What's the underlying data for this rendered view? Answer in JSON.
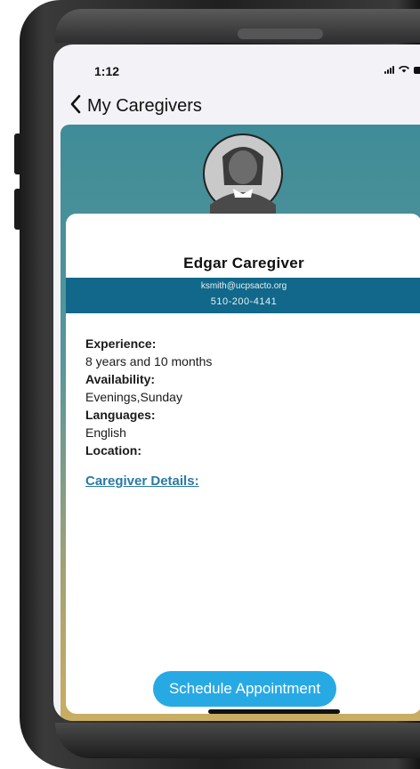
{
  "status_bar": {
    "time": "1:12"
  },
  "nav": {
    "back_title": "My Caregivers"
  },
  "profile": {
    "name": "Edgar Caregiver",
    "email": "ksmith@ucpsacto.org",
    "phone": "510-200-4141"
  },
  "details": {
    "experience_label": "Experience:",
    "experience_value": "8 years and 10 months",
    "availability_label": "Availability:",
    "availability_value": "Evenings,Sunday",
    "languages_label": "Languages:",
    "languages_value": "English",
    "location_label": "Location:",
    "location_value": ""
  },
  "links": {
    "caregiver_details": "Caregiver Details:"
  },
  "actions": {
    "schedule_label": "Schedule Appointment"
  },
  "colors": {
    "accent": "#27a9e4",
    "band": "#11688a",
    "link": "#2a7aa6",
    "gradient_top": "#3f8c98",
    "gradient_bottom": "#c9ad63"
  },
  "icons": [
    "chevron-left-icon",
    "signal-icon",
    "wifi-icon",
    "battery-icon",
    "avatar-icon"
  ]
}
